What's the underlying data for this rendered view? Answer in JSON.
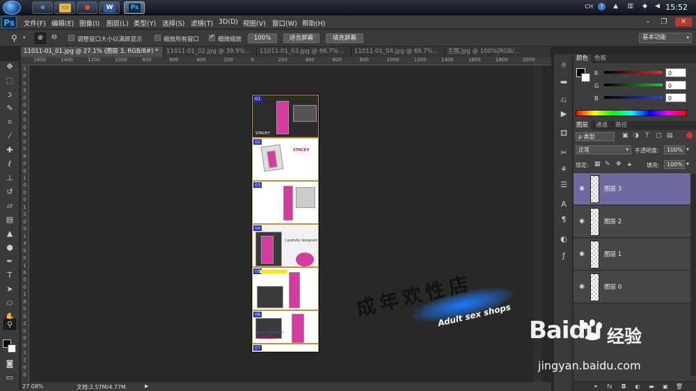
{
  "taskbar": {
    "apps": [
      {
        "name": "ie",
        "glyph": "e"
      },
      {
        "name": "explorer",
        "glyph": "▭"
      },
      {
        "name": "chrome",
        "glyph": "●"
      },
      {
        "name": "word",
        "glyph": "W"
      },
      {
        "name": "photoshop",
        "glyph": "Ps"
      }
    ],
    "tray": {
      "ime": "CH",
      "time": "15:52"
    }
  },
  "menubar": {
    "logo": "Ps",
    "items": [
      "文件(F)",
      "编辑(E)",
      "图像(I)",
      "图层(L)",
      "类型(Y)",
      "选择(S)",
      "滤镜(T)",
      "3D(D)",
      "视图(V)",
      "窗口(W)",
      "帮助(H)"
    ]
  },
  "options": {
    "resize_windows_label": "调整窗口大小以满屏显示",
    "resize_windows_checked": false,
    "zoom_all_label": "缩放所有窗口",
    "zoom_all_checked": false,
    "scrubby_zoom_label": "细微缩放",
    "scrubby_zoom_checked": true,
    "btn_100": "100%",
    "btn_fit": "适合屏幕",
    "btn_fill": "填充屏幕",
    "workspace": "基本功能"
  },
  "tabs": [
    {
      "label": "11011-01_01.jpg @ 27.1% (图层 3, RGB/8#) *",
      "active": true
    },
    {
      "label": "11011-01_02.jpg @ 39.9%...",
      "active": false
    },
    {
      "label": "11011-01_03.jpg @ 66.7%...",
      "active": false
    },
    {
      "label": "11011-01_04.jpg @ 66.7%...",
      "active": false
    },
    {
      "label": "主图.jpg @ 100%(RGB/...",
      "active": false
    }
  ],
  "ruler": {
    "h_ticks": [
      "1600",
      "1400",
      "1200",
      "1000",
      "800",
      "600",
      "400",
      "200",
      "0",
      "200",
      "400",
      "600",
      "800",
      "1000",
      "1200",
      "1400",
      "1600",
      "1800",
      "2000"
    ],
    "v_ticks": [
      "2",
      "0",
      "0",
      "2",
      "0",
      "0",
      "4",
      "0",
      "0",
      "6",
      "0",
      "0",
      "8",
      "0",
      "0",
      "1",
      "0",
      "0",
      "0",
      "1",
      "2",
      "0",
      "0",
      "1",
      "4",
      "0",
      "0",
      "1",
      "6",
      "0",
      "0",
      "1",
      "8",
      "0",
      "0",
      "2",
      "0",
      "0",
      "0",
      "2",
      "2",
      "0",
      "0"
    ]
  },
  "document": {
    "slices": [
      "01",
      "02",
      "03",
      "04",
      "05",
      "06",
      "07"
    ],
    "text_snippets": [
      "STACEY",
      "Sexy underwear",
      "STACEY",
      "Carefully designed",
      "STACEY"
    ]
  },
  "watermark": {
    "cn": "成年欢性店",
    "en": "Adult sex shops"
  },
  "status": {
    "zoom": "27.08%",
    "doc": "文档:2.57M/4.77M"
  },
  "color_panel": {
    "tabs": [
      "颜色",
      "色板"
    ],
    "channels": [
      {
        "label": "R",
        "value": "0",
        "color": "#e03030"
      },
      {
        "label": "G",
        "value": "0",
        "color": "#2bbd33"
      },
      {
        "label": "B",
        "value": "0",
        "color": "#2b47d8"
      }
    ]
  },
  "layers_panel": {
    "tabs": [
      "图层",
      "通道",
      "路径"
    ],
    "filter_label": "ρ 类型",
    "blend_mode": "正常",
    "opacity_label": "不透明度:",
    "opacity_value": "100%",
    "lock_label": "锁定:",
    "fill_label": "填充:",
    "fill_value": "100%",
    "layers": [
      {
        "name": "图层 3",
        "selected": true
      },
      {
        "name": "图层 2",
        "selected": false
      },
      {
        "name": "图层 1",
        "selected": false
      },
      {
        "name": "图层 0",
        "selected": false
      }
    ]
  },
  "baidu": {
    "brand": "Baidu",
    "cn": "经验",
    "url": "jingyan.baidu.com"
  }
}
